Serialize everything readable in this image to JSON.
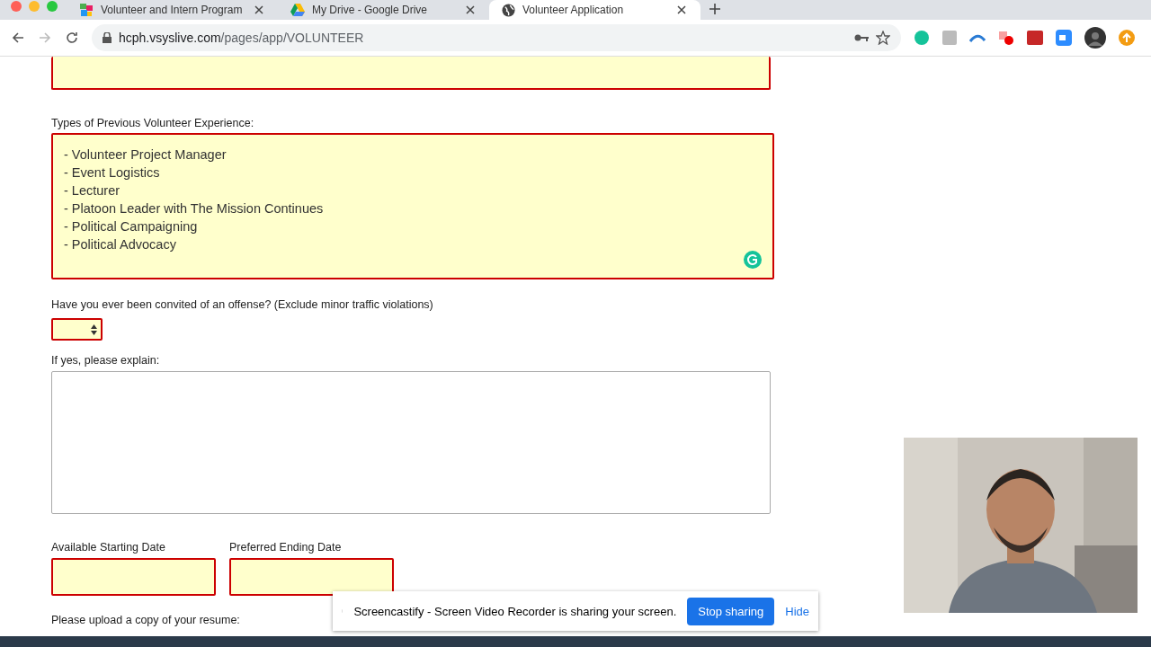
{
  "browser": {
    "tabs": [
      {
        "title": "Volunteer and Intern Program",
        "selected": false
      },
      {
        "title": "My Drive - Google Drive",
        "selected": false
      },
      {
        "title": "Volunteer Application",
        "selected": true
      }
    ],
    "url_host": "hcph.vsyslive.com",
    "url_path": "/pages/app/VOLUNTEER"
  },
  "form": {
    "top_field": {
      "required": true
    },
    "experience": {
      "label": "Types of Previous Volunteer Experience:",
      "value": "- Volunteer Project Manager\n- Event Logistics\n- Lecturer\n- Platoon Leader with The Mission Continues\n- Political Campaigning\n- Political Advocacy",
      "required": true
    },
    "convicted": {
      "label": "Have you ever been convited of an offense? (Exclude minor traffic violations)",
      "required": true
    },
    "explain": {
      "label": "If yes, please explain:",
      "required": false
    },
    "dates": [
      {
        "label": "Available Starting Date",
        "required": true
      },
      {
        "label": "Preferred Ending Date",
        "required": true
      }
    ],
    "upload_label": "Please upload a copy of your resume:"
  },
  "share_bar": {
    "message": "Screencastify - Screen Video Recorder is sharing your screen.",
    "stop": "Stop sharing",
    "hide": "Hide"
  }
}
